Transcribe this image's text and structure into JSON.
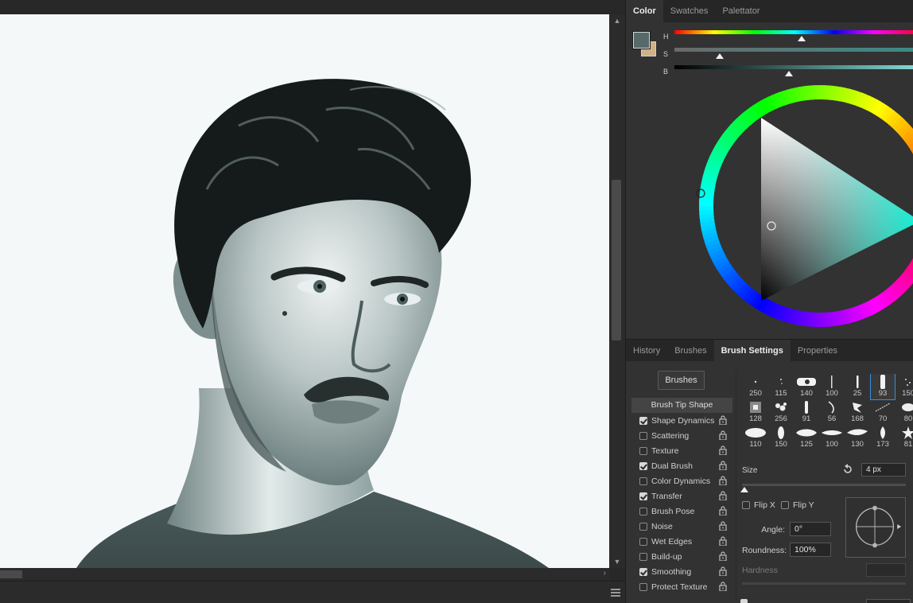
{
  "color_panel": {
    "tabs": [
      "Color",
      "Swatches",
      "Palettator"
    ],
    "active_tab": 0,
    "foreground_color": "#566a69",
    "background_color": "#cfb288",
    "sliders": [
      {
        "label": "H",
        "value_fraction": 0.53
      },
      {
        "label": "S",
        "value_fraction": 0.19
      },
      {
        "label": "B",
        "value_fraction": 0.48
      }
    ]
  },
  "brush_panel": {
    "tabs": [
      "History",
      "Brushes",
      "Brush Settings",
      "Properties"
    ],
    "active_tab": 2,
    "brushes_button": "Brushes",
    "tip_shape_label": "Brush Tip Shape",
    "options": [
      {
        "label": "Shape Dynamics",
        "checked": true
      },
      {
        "label": "Scattering",
        "checked": false
      },
      {
        "label": "Texture",
        "checked": false
      },
      {
        "label": "Dual Brush",
        "checked": true
      },
      {
        "label": "Color Dynamics",
        "checked": false
      },
      {
        "label": "Transfer",
        "checked": true
      },
      {
        "label": "Brush Pose",
        "checked": false
      },
      {
        "label": "Noise",
        "checked": false
      },
      {
        "label": "Wet Edges",
        "checked": false
      },
      {
        "label": "Build-up",
        "checked": false
      },
      {
        "label": "Smoothing",
        "checked": true
      },
      {
        "label": "Protect Texture",
        "checked": false
      }
    ],
    "tip_sizes": [
      [
        "250",
        "115",
        "140",
        "100",
        "25",
        "93",
        "150"
      ],
      [
        "128",
        "256",
        "91",
        "56",
        "168",
        "70",
        "80"
      ],
      [
        "110",
        "150",
        "125",
        "100",
        "130",
        "173",
        "81"
      ]
    ],
    "selected_tip": {
      "row": 0,
      "col": 5
    },
    "size_label": "Size",
    "size_value": "4 px",
    "flip_x_label": "Flip X",
    "flip_y_label": "Flip Y",
    "angle_label": "Angle:",
    "angle_value": "0°",
    "roundness_label": "Roundness:",
    "roundness_value": "100%",
    "hardness_label": "Hardness"
  }
}
